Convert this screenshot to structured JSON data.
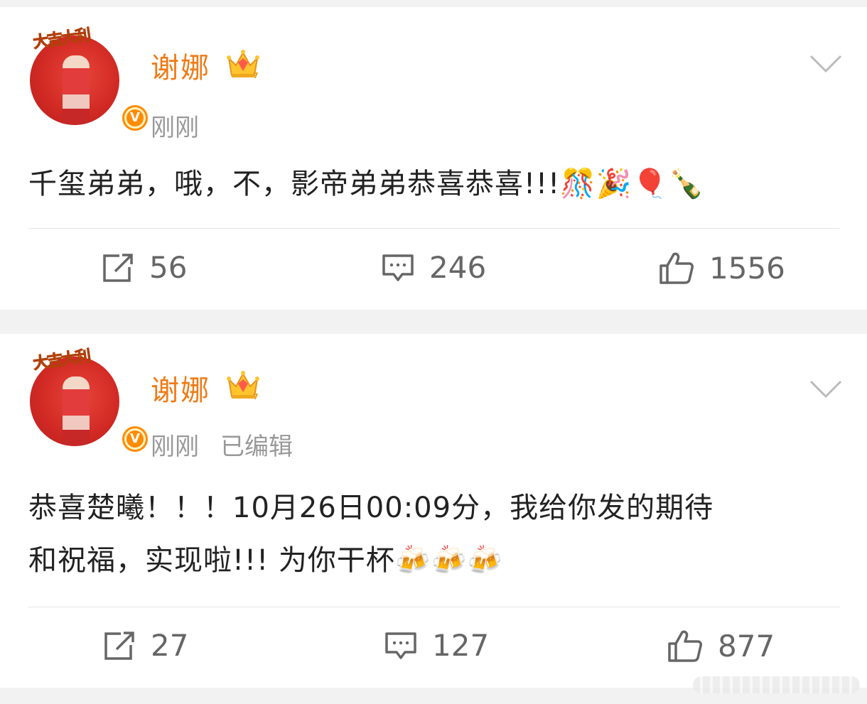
{
  "posts": [
    {
      "author": "谢娜",
      "time": "刚刚",
      "edited": "",
      "avatar_banner": "大吉大利",
      "verified_label": "V",
      "content_lines": [
        "千玺弟弟，哦，不，影帝弟弟恭喜恭喜!!!🎊🎉🎈🍾"
      ],
      "actions": {
        "repost": "56",
        "comment": "246",
        "like": "1556"
      }
    },
    {
      "author": "谢娜",
      "time": "刚刚",
      "edited": "已编辑",
      "avatar_banner": "大吉大利",
      "verified_label": "V",
      "content_lines": [
        "恭喜楚曦！！！10月26日00:09分，我给你发的期待",
        "和祝福，实现啦!!! 为你干杯🍻🍻🍻"
      ],
      "actions": {
        "repost": "27",
        "comment": "127",
        "like": "877"
      }
    }
  ],
  "icons": {
    "crown": "crown-vip-icon",
    "more": "chevron-down-icon",
    "repost": "repost-icon",
    "comment": "comment-icon",
    "like": "thumbs-up-icon"
  },
  "colors": {
    "author": "#f07a15",
    "meta": "#999999",
    "text": "#222222",
    "actions": "#666666",
    "background": "#f2f2f2"
  }
}
